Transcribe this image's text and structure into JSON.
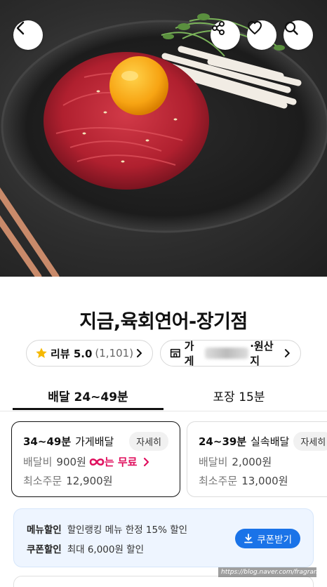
{
  "hero": {
    "alt_icon": "yukhoe-photo"
  },
  "store": {
    "name": "지금,육회연어-장기점"
  },
  "review_pill": {
    "label": "리뷰 5.0",
    "count": "(1,101)"
  },
  "info_pill": {
    "label_prefix": "가게",
    "label_suffix": "·원산지"
  },
  "tabs": [
    {
      "label": "배달 24~49분",
      "active": true
    },
    {
      "label": "포장 15분",
      "active": false
    }
  ],
  "cards": [
    {
      "time": "34~49분",
      "type": "가게배달",
      "detail": "자세히",
      "fee_key": "배달비",
      "fee_value": "900원",
      "free_text": "는 무료",
      "min_key": "최소주문",
      "min_value": "12,900원"
    },
    {
      "time": "24~39분",
      "type": "실속배달",
      "detail": "자세히",
      "fee_key": "배달비",
      "fee_value": "2,000원",
      "min_key": "최소주문",
      "min_value": "13,000원"
    }
  ],
  "discount": {
    "menu_key": "메뉴할인",
    "menu_value": "할인랭킹 메뉴 한정 15% 할인",
    "coupon_key": "쿠폰할인",
    "coupon_value": "최대 6,000원 할인",
    "coupon_button": "쿠폰받기"
  },
  "watermark": "https://blog.naver.com/fragrance2021",
  "colors": {
    "accent_blue": "#1a73e8",
    "free_pink": "#e0115f",
    "star": "#f5b800"
  }
}
